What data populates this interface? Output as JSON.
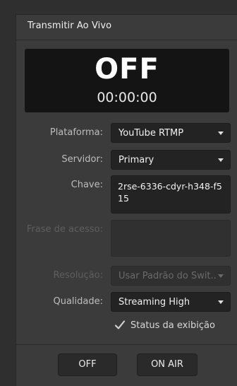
{
  "header": {
    "title": "Transmitir Ao Vivo"
  },
  "status": {
    "state": "OFF",
    "timer": "00:00:00"
  },
  "form": {
    "platform": {
      "label": "Plataforma:",
      "value": "YouTube RTMP"
    },
    "server": {
      "label": "Servidor:",
      "value": "Primary"
    },
    "key": {
      "label": "Chave:",
      "value": "2rse-6336-cdyr-h348-f515"
    },
    "passphrase": {
      "label": "Frase de acesso:",
      "value": ""
    },
    "resolution": {
      "label": "Resolução:",
      "value": "Usar Padrão do Swit..."
    },
    "quality": {
      "label": "Qualidade:",
      "value": "Streaming High"
    },
    "show_status": {
      "label": "Status da exibição",
      "checked": true
    }
  },
  "buttons": {
    "off": "OFF",
    "on_air": "ON AIR"
  },
  "colors": {
    "panel_bg": "#3b3b3b",
    "field_bg": "#232323",
    "status_bg": "#141414"
  }
}
